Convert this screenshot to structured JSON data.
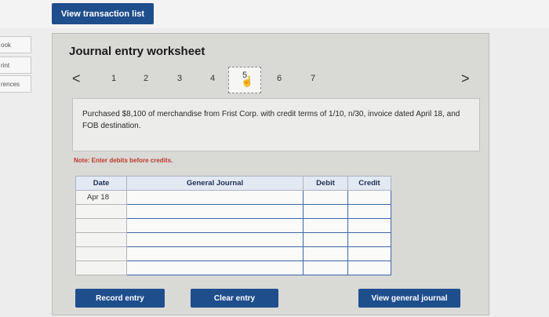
{
  "topbar": {
    "view_transaction_list": "View transaction list"
  },
  "side_tabs": [
    "ook",
    "rint",
    "rences"
  ],
  "worksheet": {
    "title": "Journal entry worksheet",
    "pager": {
      "prev": "<",
      "next": ">",
      "pages": [
        "1",
        "2",
        "3",
        "4",
        "5",
        "6",
        "7"
      ],
      "active_page": "5"
    },
    "description": "Purchased $8,100 of merchandise from Frist Corp. with credit terms of 1/10, n/30, invoice dated April 18, and FOB destination.",
    "note": "Note: Enter debits before credits."
  },
  "journal": {
    "headers": {
      "date": "Date",
      "account": "General Journal",
      "debit": "Debit",
      "credit": "Credit"
    },
    "rows": [
      {
        "date": "Apr 18",
        "account": "",
        "debit": "",
        "credit": ""
      },
      {
        "date": "",
        "account": "",
        "debit": "",
        "credit": ""
      },
      {
        "date": "",
        "account": "",
        "debit": "",
        "credit": ""
      },
      {
        "date": "",
        "account": "",
        "debit": "",
        "credit": ""
      },
      {
        "date": "",
        "account": "",
        "debit": "",
        "credit": ""
      },
      {
        "date": "",
        "account": "",
        "debit": "",
        "credit": ""
      }
    ]
  },
  "buttons": {
    "record_entry": "Record entry",
    "clear_entry": "Clear entry",
    "view_general_journal": "View general journal"
  }
}
